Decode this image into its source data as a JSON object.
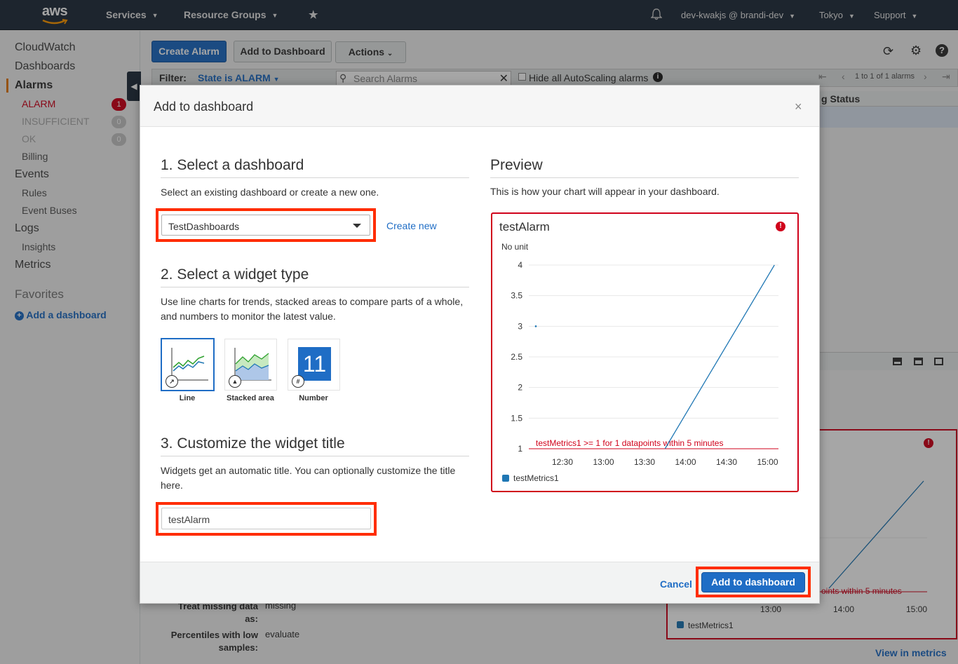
{
  "topnav": {
    "logo": "aws",
    "services": "Services",
    "resource_groups": "Resource Groups",
    "account": "dev-kwakjs @ brandi-dev",
    "region": "Tokyo",
    "support": "Support"
  },
  "sidebar": {
    "cloudwatch": "CloudWatch",
    "dashboards": "Dashboards",
    "alarms": "Alarms",
    "alarm": "ALARM",
    "alarm_count": "1",
    "insufficient": "INSUFFICIENT",
    "insufficient_count": "0",
    "ok": "OK",
    "ok_count": "0",
    "billing": "Billing",
    "events": "Events",
    "rules": "Rules",
    "event_buses": "Event Buses",
    "logs": "Logs",
    "insights": "Insights",
    "metrics": "Metrics",
    "favorites": "Favorites",
    "add_dashboard": "Add a dashboard"
  },
  "toolbar": {
    "create_alarm": "Create Alarm",
    "add_to_dashboard": "Add to Dashboard",
    "actions": "Actions",
    "filter_label": "Filter:",
    "filter_value": "State is ALARM",
    "search_placeholder": "Search Alarms",
    "hide_autoscaling": "Hide all AutoScaling alarms",
    "pager": "1 to 1 of 1 alarms",
    "status_col": "g Status"
  },
  "modal": {
    "title": "Add to dashboard",
    "close": "×",
    "section1_title": "1. Select a dashboard",
    "section1_desc": "Select an existing dashboard or create a new one.",
    "dashboard_selected": "TestDashboards",
    "create_new": "Create new",
    "section2_title": "2. Select a widget type",
    "section2_desc": "Use line charts for trends, stacked areas to compare parts of a whole, and numbers to monitor the latest value.",
    "widget_types": [
      {
        "label": "Line"
      },
      {
        "label": "Stacked area"
      },
      {
        "label": "Number"
      }
    ],
    "number_icon_value": "11",
    "section3_title": "3. Customize the widget title",
    "section3_desc": "Widgets get an automatic title. You can optionally customize the title here.",
    "widget_title_value": "testAlarm",
    "preview_title": "Preview",
    "preview_desc": "This is how your chart will appear in your dashboard.",
    "cancel": "Cancel",
    "add_button": "Add to dashboard"
  },
  "chart_data": {
    "type": "line",
    "title": "testAlarm",
    "ylabel": "No unit",
    "x": [
      "12:30",
      "13:00",
      "13:30",
      "14:00",
      "14:30",
      "15:00"
    ],
    "yticks": [
      "4",
      "3.5",
      "3",
      "2.5",
      "2",
      "1.5",
      "1"
    ],
    "ylim": [
      1,
      4
    ],
    "series": [
      {
        "name": "testMetrics1",
        "points": [
          [
            "12:30",
            3
          ],
          [
            "13:45",
            1
          ],
          [
            "15:05",
            4
          ]
        ]
      }
    ],
    "threshold": {
      "value": 1,
      "label": "testMetrics1 >= 1 for 1 datapoints within 5 minutes"
    },
    "series_color": "#1f77b4",
    "threshold_color": "#d0021b"
  },
  "under": {
    "treat_missing_label": "Treat missing data as:",
    "treat_missing_value": "missing",
    "percentiles_label": "Percentiles with low samples:",
    "percentiles_value": "evaluate",
    "threshold_fragment": "oints within 5 minutes",
    "x": [
      "13:00",
      "14:00",
      "15:00"
    ],
    "legend": "testMetrics1",
    "view_in_metrics": "View in metrics"
  }
}
